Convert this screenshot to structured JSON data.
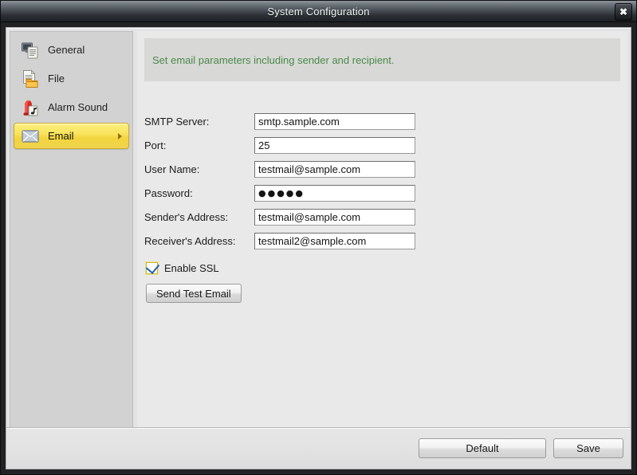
{
  "window": {
    "title": "System Configuration",
    "close_label": "✖"
  },
  "sidebar": {
    "items": [
      {
        "label": "General",
        "icon": "monitor-document-icon",
        "active": false
      },
      {
        "label": "File",
        "icon": "document-folder-icon",
        "active": false
      },
      {
        "label": "Alarm Sound",
        "icon": "alarm-siren-icon",
        "active": false
      },
      {
        "label": "Email",
        "icon": "envelope-icon",
        "active": true
      }
    ]
  },
  "content": {
    "banner_text": "Set email parameters including sender and recipient.",
    "fields": [
      {
        "label": "SMTP Server:",
        "value": "smtp.sample.com",
        "type": "text"
      },
      {
        "label": "Port:",
        "value": "25",
        "type": "text"
      },
      {
        "label": "User Name:",
        "value": "testmail@sample.com",
        "type": "text"
      },
      {
        "label": "Password:",
        "value": "●●●●●",
        "type": "password"
      },
      {
        "label": "Sender's Address:",
        "value": "testmail@sample.com",
        "type": "text"
      },
      {
        "label": "Receiver's Address:",
        "value": "testmail2@sample.com",
        "type": "text"
      }
    ],
    "ssl": {
      "label": "Enable SSL",
      "checked": true
    },
    "test_button_label": "Send Test Email"
  },
  "footer": {
    "default_label": "Default",
    "save_label": "Save"
  },
  "colors": {
    "accent_yellow": "#f3d43d",
    "banner_green": "#4a8a4a",
    "titlebar_dark": "#2b2f34"
  }
}
